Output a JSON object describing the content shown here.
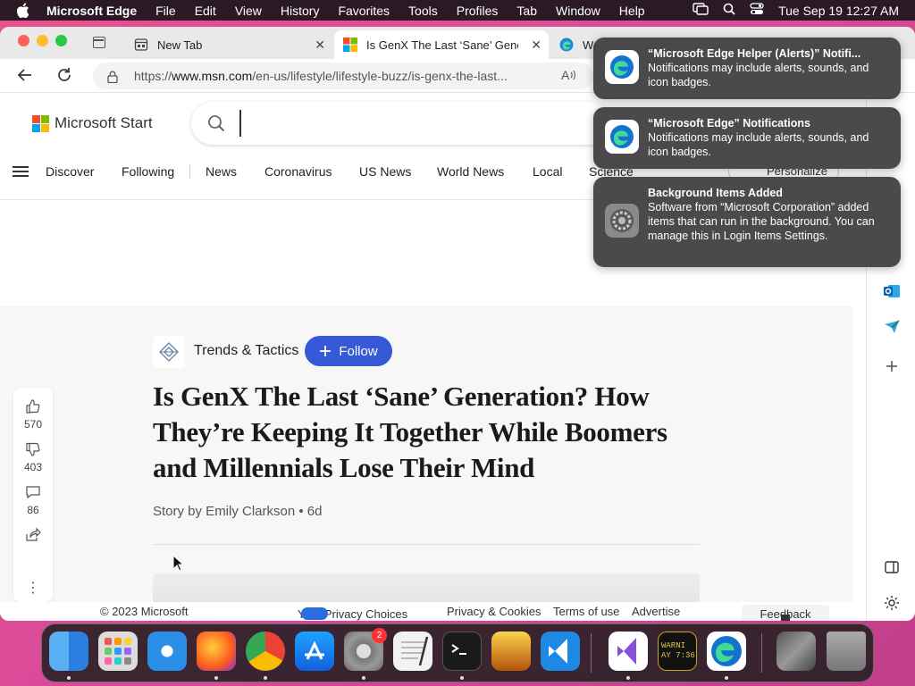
{
  "menubar": {
    "app": "Microsoft Edge",
    "items": [
      "File",
      "Edit",
      "View",
      "History",
      "Favorites",
      "Tools",
      "Profiles",
      "Tab",
      "Window",
      "Help"
    ],
    "clock": "Tue Sep 19  12:27 AM"
  },
  "tabs": [
    {
      "title": "New Tab"
    },
    {
      "title": "Is GenX The Last ‘Sane’ Generation"
    },
    {
      "title": "We"
    }
  ],
  "address": {
    "url_prefix": "https://",
    "url_domain": "www.msn.com",
    "url_path": "/en-us/lifestyle/lifestyle-buzz/is-genx-the-last..."
  },
  "msn": {
    "logo_text": "Microsoft Start",
    "search_placeholder": "",
    "nav": [
      "Discover",
      "Following",
      "News",
      "Coronavirus",
      "US News",
      "World News",
      "Local",
      "Science"
    ],
    "personalize": "Personalize"
  },
  "article": {
    "publisher": "Trends & Tactics",
    "follow_label": "Follow",
    "headline": "Is GenX The Last ‘Sane’ Generation? How They’re Keeping It Together While Boomers and Millennials Lose Their Mind",
    "byline": "Story by Emily Clarkson • 6d",
    "likes": "570",
    "dislikes": "403",
    "comments": "86"
  },
  "footer": {
    "copyright": "© 2023 Microsoft",
    "privacy_choices": "Your Privacy Choices",
    "privacy_cookies": "Privacy & Cookies",
    "terms": "Terms of use",
    "advertise": "Advertise",
    "feedback": "Feedback"
  },
  "notifications": [
    {
      "title": "“Microsoft Edge Helper (Alerts)” Notifi...",
      "body": "Notifications may include alerts, sounds, and icon badges."
    },
    {
      "title": "“Microsoft Edge” Notifications",
      "body": "Notifications may include alerts, sounds, and icon badges."
    },
    {
      "title": "Background Items Added",
      "body": "Software from “Microsoft Corporation” added items that can run in the background. You can manage this in Login Items Settings."
    }
  ],
  "dock": {
    "settings_badge": "2",
    "console_text": "WARNI\nAY 7:36"
  },
  "colors": {
    "accent": "#3659d7",
    "menubar": "#2b1a24",
    "notification": "#3c3c3e"
  }
}
